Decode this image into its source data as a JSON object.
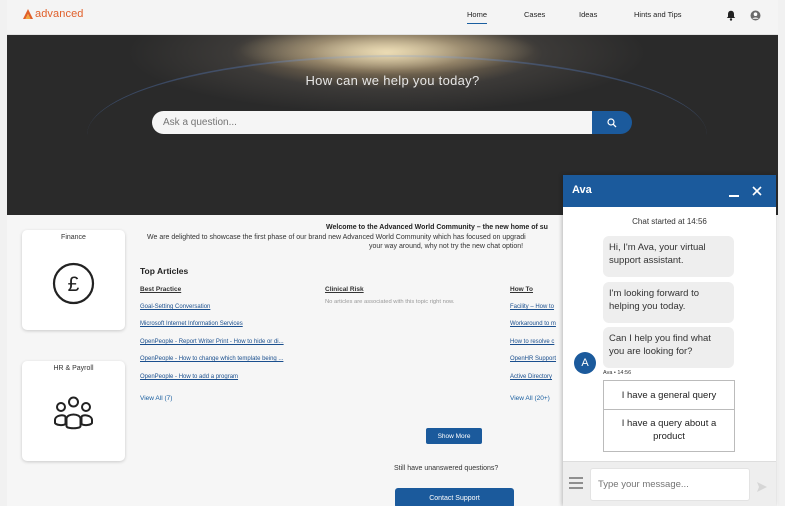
{
  "header": {
    "logo_text": "advanced",
    "nav": [
      "Home",
      "Cases",
      "Ideas",
      "Hints and Tips"
    ],
    "active_nav": "Home"
  },
  "hero": {
    "title": "How can we help you today?",
    "search_placeholder": "Ask a question..."
  },
  "cards": [
    {
      "title": "Finance",
      "icon": "pound-coin-icon"
    },
    {
      "title": "HR & Payroll",
      "icon": "people-group-icon"
    }
  ],
  "welcome": {
    "title": "Welcome to the Advanced World Community – the new home of su",
    "line1": "We are delighted to showcase the first phase of our brand new Advanced World Community which has focused on upgradi",
    "line2": "your way around, why not try the new chat option!"
  },
  "articles": {
    "heading": "Top Articles",
    "columns": [
      {
        "title": "Best Practice",
        "links": [
          "Goal-Setting Conversation",
          "Microsoft Internet Information Services",
          "OpenPeople - Report Writer Print - How to hide or di...",
          "OpenPeople - How to change which template being ...",
          "OpenPeople - How to add a program"
        ],
        "view_all": "View All (7)"
      },
      {
        "title": "Clinical Risk",
        "empty": "No articles are associated with this topic right now."
      },
      {
        "title": "How To",
        "links": [
          "Facility – How to",
          "Workaround to m",
          "How to resolve c",
          "OpenHR Support",
          "Active Directory"
        ],
        "view_all": "View All (20+)"
      }
    ],
    "show_more": "Show More"
  },
  "support": {
    "question": "Still have unanswered questions?",
    "contact": "Contact Support"
  },
  "chat": {
    "title": "Ava",
    "started": "Chat started at 14:56",
    "messages": [
      "Hi, I'm Ava, your virtual support assistant.",
      "I'm looking forward to helping you today.",
      "Can I help you find what you are looking for?"
    ],
    "avatar_letter": "A",
    "meta": "Ava • 14:56",
    "options": [
      "I have a general query",
      "I have a query about a product"
    ],
    "input_placeholder": "Type your message...",
    "colors": {
      "brand": "#1b5a9c",
      "accent": "#e05f2a"
    }
  }
}
